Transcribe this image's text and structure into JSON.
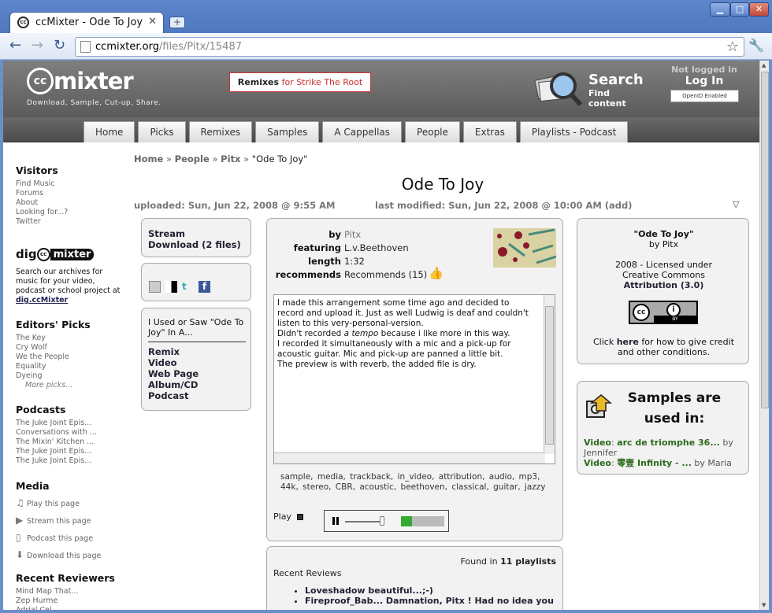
{
  "browser": {
    "tab_title": "ccMixter - Ode To Joy",
    "new_tab": "+",
    "url_host": "ccmixter.org",
    "url_path": "/files/Pitx/15487",
    "min": "▁",
    "max": "□",
    "close": "✕",
    "back": "←",
    "forward": "→",
    "reload": "↻",
    "star": "☆",
    "wrench": "🔧"
  },
  "header": {
    "logo_cc": "cc",
    "logo_word": "mixter",
    "tagline": "Download, Sample, Cut-up, Share.",
    "promo_bold": "Remixes",
    "promo_rest": " for Strike The Root",
    "search_title": "Search",
    "search_sub1": "Find",
    "search_sub2": "content",
    "not_logged": "Not logged in",
    "login": "Log In",
    "openid": "OpenID Enabled"
  },
  "tabs": [
    "Home",
    "Picks",
    "Remixes",
    "Samples",
    "A Cappellas",
    "People",
    "Extras",
    "Playlists - Podcast"
  ],
  "sidebar": {
    "visitors_title": "Visitors",
    "visitors": [
      "Find Music",
      "Forums",
      "About",
      "Looking for...?",
      "Twitter"
    ],
    "dig_cc": "cc",
    "dig_pre": "dig",
    "dig_word": "mixter",
    "dig_text": "Search our archives for music for your video, podcast or school project at ",
    "dig_link": "dig.ccMixter",
    "picks_title": "Editors' Picks",
    "picks": [
      "The Key",
      "Cry Wolf",
      "We the People",
      "Equality",
      "Dyeing"
    ],
    "picks_more": "More picks...",
    "podcasts_title": "Podcasts",
    "podcasts": [
      "The Juke Joint Epis...",
      "Conversations with ...",
      "The Mixin' Kitchen ...",
      "The Juke Joint Epis...",
      "The Juke Joint Epis..."
    ],
    "media_title": "Media",
    "media": [
      "Play this page",
      "Stream this page",
      "Podcast this page",
      "Download this page"
    ],
    "reviewers_title": "Recent Reviewers",
    "reviewers": [
      "Mind Map That...",
      "Zep Hurme",
      "Adrial Cel..."
    ]
  },
  "main": {
    "crumb_home": "Home",
    "crumb_people": "People",
    "crumb_user": "Pitx",
    "crumb_sep": "»",
    "crumb_cur": "\"Ode To Joy\"",
    "title": "Ode To Joy",
    "uploaded": "uploaded: Sun, Jun 22, 2008 @ 9:55 AM",
    "modified": "last modified: Sun, Jun 22, 2008 @ 10:00 AM  (add)",
    "stream": "Stream",
    "download": "Download (2 files)",
    "used_text": "I Used or Saw \"Ode To Joy\" In A...",
    "used_links": [
      "Remix",
      "Video",
      "Web Page",
      "Album/CD",
      "Podcast"
    ],
    "by_k": "by",
    "by_v": "Pitx",
    "feat_k": "featuring",
    "feat_v": "L.v.Beethoven",
    "len_k": "length",
    "len_v": "1:32",
    "rec_k": "recommends",
    "rec_v": "Recommends (15)",
    "description_1": "I made this arrangement some time ago and decided to record and upload it. Just as well Ludwig is deaf and couldn't listen to this very-personal-version.",
    "description_2a": "Didn't recorded ",
    "description_2b": "a tempo",
    "description_2c": " because i like more in this way.",
    "description_3": "I recorded it simultaneously with a mic and a pick-up for acoustic guitar. Mic and pick-up are panned a little bit.",
    "description_4": "The preview is with reverb, the added file is dry.",
    "tags": "sample,  media,  trackback,  in_video,  attribution,  audio,  mp3,  44k,  stereo,  CBR,  acoustic,  beethoven,  classical,  guitar,  jazzy",
    "play_label": "Play",
    "found_pre": "Found in ",
    "found_num": "11 playlists",
    "reviews_title": "Recent Reviews",
    "reviews": [
      "Loveshadow beautiful...;-)",
      "Fireproof_Bab... Damnation, Pitx ! Had no idea you"
    ]
  },
  "license": {
    "title": "\"Ode To Joy\"",
    "by": "by Pitx",
    "year": "2008 - Licensed under",
    "cc": "Creative Commons",
    "attr": "Attribution (3.0)",
    "click_pre": "Click ",
    "click_here": "here",
    "click_post": " for how to give credit and other conditions.",
    "badge_cc": "cc",
    "badge_by": "BY",
    "badge_i": "i"
  },
  "samples": {
    "title": "Samples are used in:",
    "items": [
      {
        "type": "Video",
        "name": "arc de triomphe 36...",
        "by": " by Jennifer"
      },
      {
        "type": "Video",
        "name": "零壹 Infinity - ...",
        "by": " by Maria"
      }
    ]
  },
  "colors": {
    "header_gray": "#6b6b6b",
    "chrome_blue": "#5e86cc",
    "promo_red": "#cc3333",
    "link_green": "#2a6a1a"
  }
}
